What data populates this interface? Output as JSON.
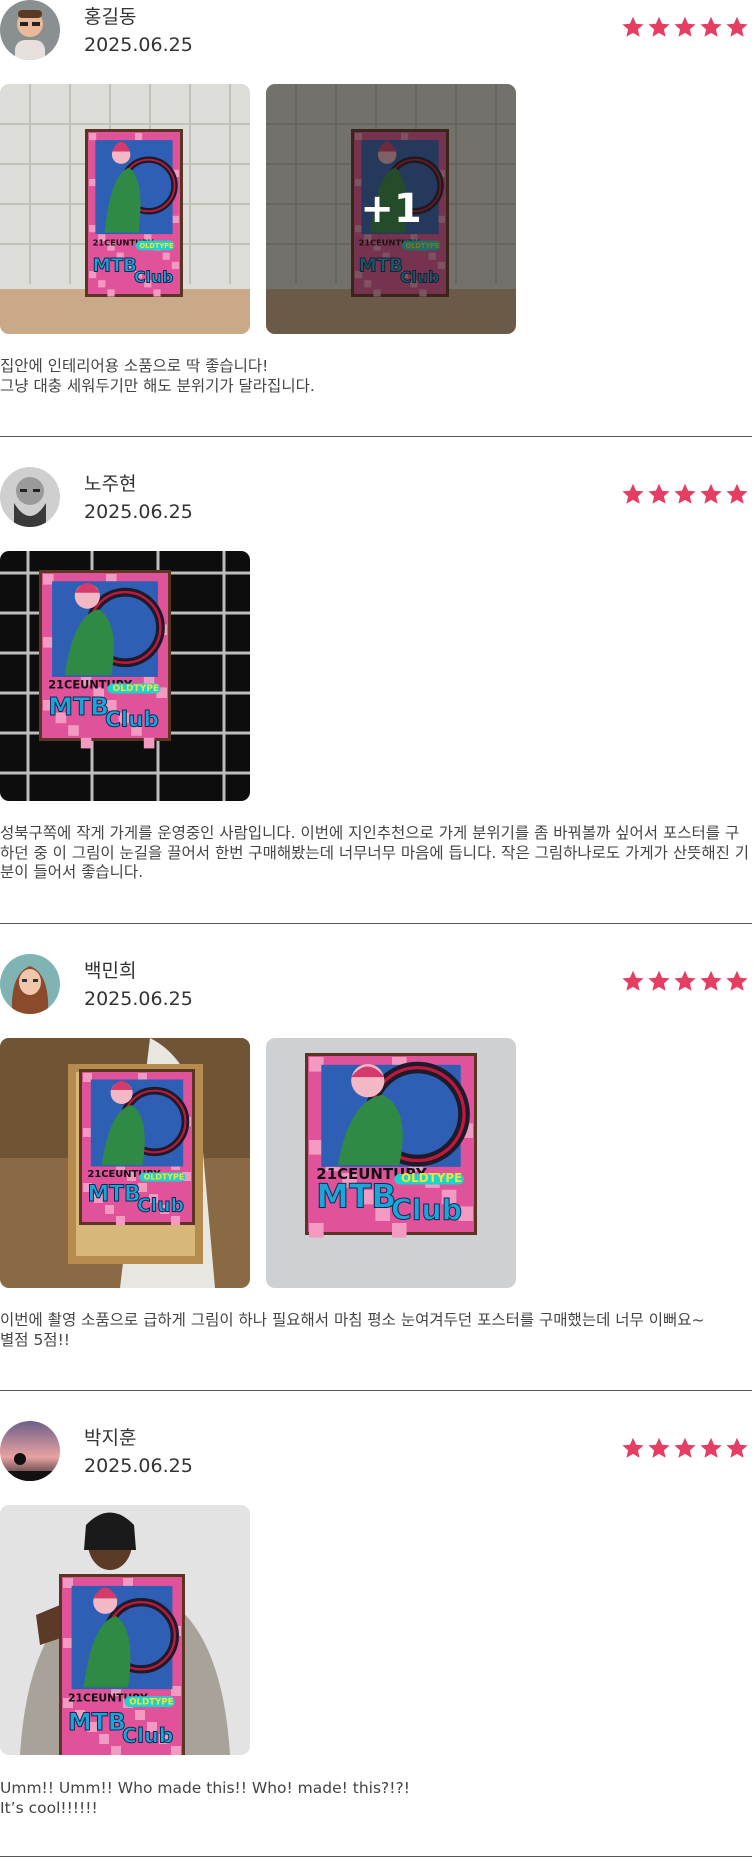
{
  "reviews": [
    {
      "name": "홍길동",
      "date": "2025.06.25",
      "rating": 5,
      "photo_more": "+1",
      "text": "집안에 인테리어용 소품으로 딱 좋습니다!\n그냥 대충 세워두기만 해도 분위기가 달라집니다."
    },
    {
      "name": "노주현",
      "date": "2025.06.25",
      "rating": 5,
      "text": "성북구쪽에 작게 가게를 운영중인 사람입니다. 이번에 지인추천으로 가게 분위기를 좀 바꿔볼까 싶어서 포스터를 구하던 중 이 그림이 눈길을 끌어서 한번 구매해봤는데 너무너무 마음에 듭니다. 작은 그림하나로도 가게가 산뜻해진 기분이 들어서 좋습니다."
    },
    {
      "name": "백민희",
      "date": "2025.06.25",
      "rating": 5,
      "text": "이번에 촬영 소품으로 급하게 그림이 하나 필요해서 마침 평소 눈여겨두던 포스터를 구매했는데 너무 이뻐요~\n별점 5점!!"
    },
    {
      "name": "박지훈",
      "date": "2025.06.25",
      "rating": 5,
      "text": "Umm!! Umm!! Who made this!! Who! made! this?!?!\nIt’s cool!!!!!!"
    }
  ],
  "poster": {
    "line1": "21CEUNTURY",
    "line2": "OLDTYPE",
    "line3": "MTB",
    "line4": "Club"
  },
  "colors": {
    "star": "#e63d62",
    "poster_pink": "#e0529a",
    "poster_blue": "#2f5fb5",
    "poster_green": "#2e8a45"
  }
}
